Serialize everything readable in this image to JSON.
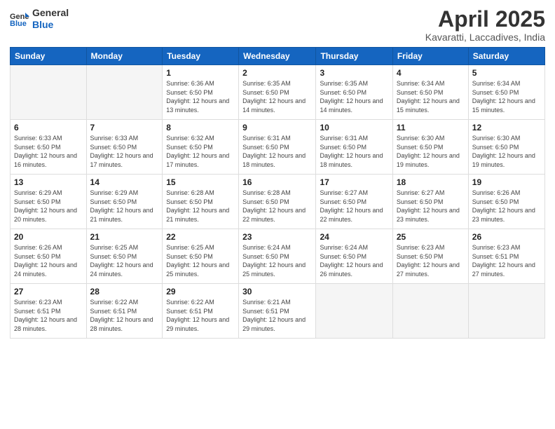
{
  "header": {
    "logo_general": "General",
    "logo_blue": "Blue",
    "title": "April 2025",
    "location": "Kavaratti, Laccadives, India"
  },
  "weekdays": [
    "Sunday",
    "Monday",
    "Tuesday",
    "Wednesday",
    "Thursday",
    "Friday",
    "Saturday"
  ],
  "weeks": [
    [
      {
        "day": "",
        "info": ""
      },
      {
        "day": "",
        "info": ""
      },
      {
        "day": "1",
        "info": "Sunrise: 6:36 AM\nSunset: 6:50 PM\nDaylight: 12 hours and 13 minutes."
      },
      {
        "day": "2",
        "info": "Sunrise: 6:35 AM\nSunset: 6:50 PM\nDaylight: 12 hours and 14 minutes."
      },
      {
        "day": "3",
        "info": "Sunrise: 6:35 AM\nSunset: 6:50 PM\nDaylight: 12 hours and 14 minutes."
      },
      {
        "day": "4",
        "info": "Sunrise: 6:34 AM\nSunset: 6:50 PM\nDaylight: 12 hours and 15 minutes."
      },
      {
        "day": "5",
        "info": "Sunrise: 6:34 AM\nSunset: 6:50 PM\nDaylight: 12 hours and 15 minutes."
      }
    ],
    [
      {
        "day": "6",
        "info": "Sunrise: 6:33 AM\nSunset: 6:50 PM\nDaylight: 12 hours and 16 minutes."
      },
      {
        "day": "7",
        "info": "Sunrise: 6:33 AM\nSunset: 6:50 PM\nDaylight: 12 hours and 17 minutes."
      },
      {
        "day": "8",
        "info": "Sunrise: 6:32 AM\nSunset: 6:50 PM\nDaylight: 12 hours and 17 minutes."
      },
      {
        "day": "9",
        "info": "Sunrise: 6:31 AM\nSunset: 6:50 PM\nDaylight: 12 hours and 18 minutes."
      },
      {
        "day": "10",
        "info": "Sunrise: 6:31 AM\nSunset: 6:50 PM\nDaylight: 12 hours and 18 minutes."
      },
      {
        "day": "11",
        "info": "Sunrise: 6:30 AM\nSunset: 6:50 PM\nDaylight: 12 hours and 19 minutes."
      },
      {
        "day": "12",
        "info": "Sunrise: 6:30 AM\nSunset: 6:50 PM\nDaylight: 12 hours and 19 minutes."
      }
    ],
    [
      {
        "day": "13",
        "info": "Sunrise: 6:29 AM\nSunset: 6:50 PM\nDaylight: 12 hours and 20 minutes."
      },
      {
        "day": "14",
        "info": "Sunrise: 6:29 AM\nSunset: 6:50 PM\nDaylight: 12 hours and 21 minutes."
      },
      {
        "day": "15",
        "info": "Sunrise: 6:28 AM\nSunset: 6:50 PM\nDaylight: 12 hours and 21 minutes."
      },
      {
        "day": "16",
        "info": "Sunrise: 6:28 AM\nSunset: 6:50 PM\nDaylight: 12 hours and 22 minutes."
      },
      {
        "day": "17",
        "info": "Sunrise: 6:27 AM\nSunset: 6:50 PM\nDaylight: 12 hours and 22 minutes."
      },
      {
        "day": "18",
        "info": "Sunrise: 6:27 AM\nSunset: 6:50 PM\nDaylight: 12 hours and 23 minutes."
      },
      {
        "day": "19",
        "info": "Sunrise: 6:26 AM\nSunset: 6:50 PM\nDaylight: 12 hours and 23 minutes."
      }
    ],
    [
      {
        "day": "20",
        "info": "Sunrise: 6:26 AM\nSunset: 6:50 PM\nDaylight: 12 hours and 24 minutes."
      },
      {
        "day": "21",
        "info": "Sunrise: 6:25 AM\nSunset: 6:50 PM\nDaylight: 12 hours and 24 minutes."
      },
      {
        "day": "22",
        "info": "Sunrise: 6:25 AM\nSunset: 6:50 PM\nDaylight: 12 hours and 25 minutes."
      },
      {
        "day": "23",
        "info": "Sunrise: 6:24 AM\nSunset: 6:50 PM\nDaylight: 12 hours and 25 minutes."
      },
      {
        "day": "24",
        "info": "Sunrise: 6:24 AM\nSunset: 6:50 PM\nDaylight: 12 hours and 26 minutes."
      },
      {
        "day": "25",
        "info": "Sunrise: 6:23 AM\nSunset: 6:50 PM\nDaylight: 12 hours and 27 minutes."
      },
      {
        "day": "26",
        "info": "Sunrise: 6:23 AM\nSunset: 6:51 PM\nDaylight: 12 hours and 27 minutes."
      }
    ],
    [
      {
        "day": "27",
        "info": "Sunrise: 6:23 AM\nSunset: 6:51 PM\nDaylight: 12 hours and 28 minutes."
      },
      {
        "day": "28",
        "info": "Sunrise: 6:22 AM\nSunset: 6:51 PM\nDaylight: 12 hours and 28 minutes."
      },
      {
        "day": "29",
        "info": "Sunrise: 6:22 AM\nSunset: 6:51 PM\nDaylight: 12 hours and 29 minutes."
      },
      {
        "day": "30",
        "info": "Sunrise: 6:21 AM\nSunset: 6:51 PM\nDaylight: 12 hours and 29 minutes."
      },
      {
        "day": "",
        "info": ""
      },
      {
        "day": "",
        "info": ""
      },
      {
        "day": "",
        "info": ""
      }
    ]
  ]
}
